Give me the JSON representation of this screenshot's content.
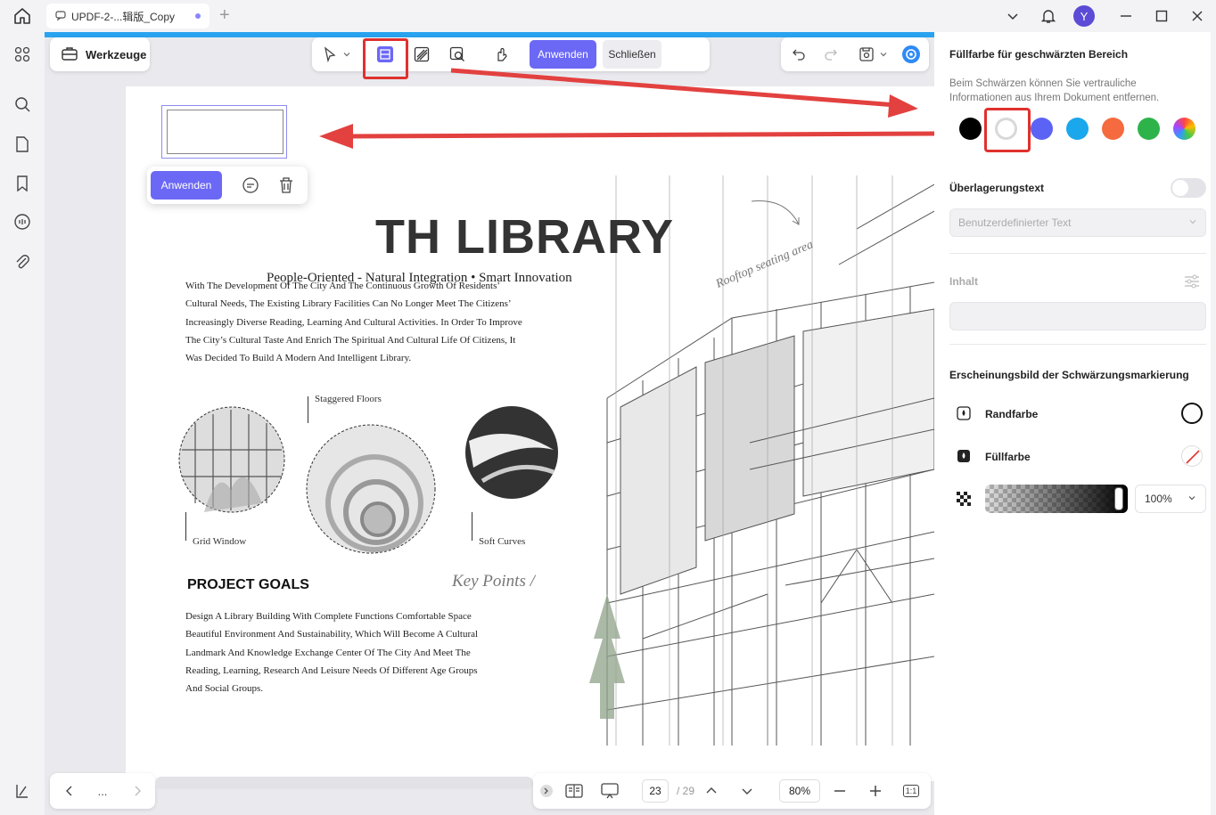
{
  "window": {
    "tab_title": "UPDF-2-...辑版_Copy",
    "avatar_letter": "Y"
  },
  "toolbar": {
    "tools_label": "Werkzeuge",
    "apply_label": "Anwenden",
    "close_label": "Schließen"
  },
  "redaction_popup": {
    "apply_label": "Anwenden"
  },
  "document": {
    "title": "TH LIBRARY",
    "subtitle": "People-Oriented - Natural Integration • Smart Innovation",
    "intro_lines": [
      "With The Development Of The City And The Continuous Growth Of Residents’",
      "Cultural Needs, The Existing Library Facilities Can No Longer Meet The Citizens’",
      "Increasingly Diverse Reading, Learning And Cultural Activities. In Order To Improve",
      "The City’s Cultural Taste And Enrich The Spiritual And Cultural Life Of Citizens, It",
      "Was Decided To Build A Modern And Intelligent Library."
    ],
    "image_labels": {
      "grid_window": "Grid Window",
      "staggered_floors": "Staggered Floors",
      "soft_curves": "Soft Curves"
    },
    "rooftop_note": "Rooftop seating area",
    "goals_title": "PROJECT GOALS",
    "key_points": "Key Points /",
    "goals_lines": [
      "Design A Library Building With Complete Functions Comfortable Space",
      "Beautiful Environment And Sustainability, Which Will Become A Cultural",
      "Landmark And Knowledge Exchange Center Of The City And Meet The",
      "Reading, Learning, Research And Leisure Needs Of Different Age Groups",
      "And Social Groups."
    ]
  },
  "bottom_bar": {
    "more_label": "...",
    "current_page": "23",
    "total_pages": "/ 29",
    "zoom": "80%",
    "fit_label": "1:1"
  },
  "right_panel": {
    "fill_title": "Füllfarbe für geschwärzten Bereich",
    "fill_desc": "Beim Schwärzen können Sie vertrauliche Informationen aus Ihrem Dokument entfernen.",
    "colors": [
      "#000000",
      "#ffffff",
      "#5b63f5",
      "#1aa7ec",
      "#f56a3e",
      "#2db34a",
      "rainbow"
    ],
    "overlay_label": "Überlagerungstext",
    "overlay_select": "Benutzerdefinierter Text",
    "content_label": "Inhalt",
    "appearance_title": "Erscheinungsbild der Schwärzungsmarkierung",
    "border_color_label": "Randfarbe",
    "fill_color_label": "Füllfarbe",
    "opacity": "100%"
  }
}
